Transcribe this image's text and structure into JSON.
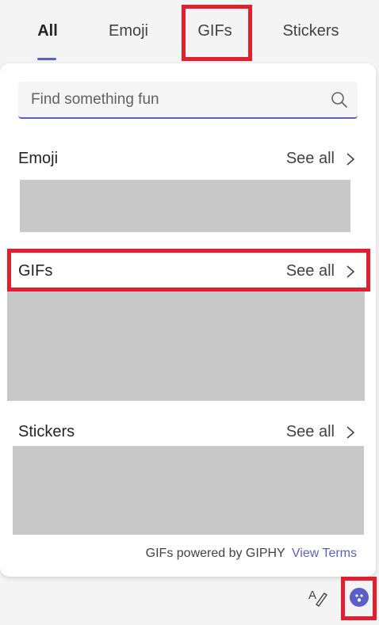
{
  "tabs": [
    {
      "label": "All",
      "active": true
    },
    {
      "label": "Emoji",
      "active": false
    },
    {
      "label": "GIFs",
      "active": false
    },
    {
      "label": "Stickers",
      "active": false
    }
  ],
  "search": {
    "placeholder": "Find something fun",
    "icon": "search-icon"
  },
  "sections": [
    {
      "title": "Emoji",
      "see_all": "See all"
    },
    {
      "title": "GIFs",
      "see_all": "See all"
    },
    {
      "title": "Stickers",
      "see_all": "See all"
    }
  ],
  "footer": {
    "powered_by": "GIFs powered by GIPHY",
    "view_terms": "View Terms"
  },
  "toolbar": {
    "format_icon": "format-text-icon",
    "sticker_icon": "sticker-face-icon"
  },
  "colors": {
    "accent": "#5b5fc7",
    "highlight": "#e0202e",
    "placeholder": "#c8c8c8"
  }
}
